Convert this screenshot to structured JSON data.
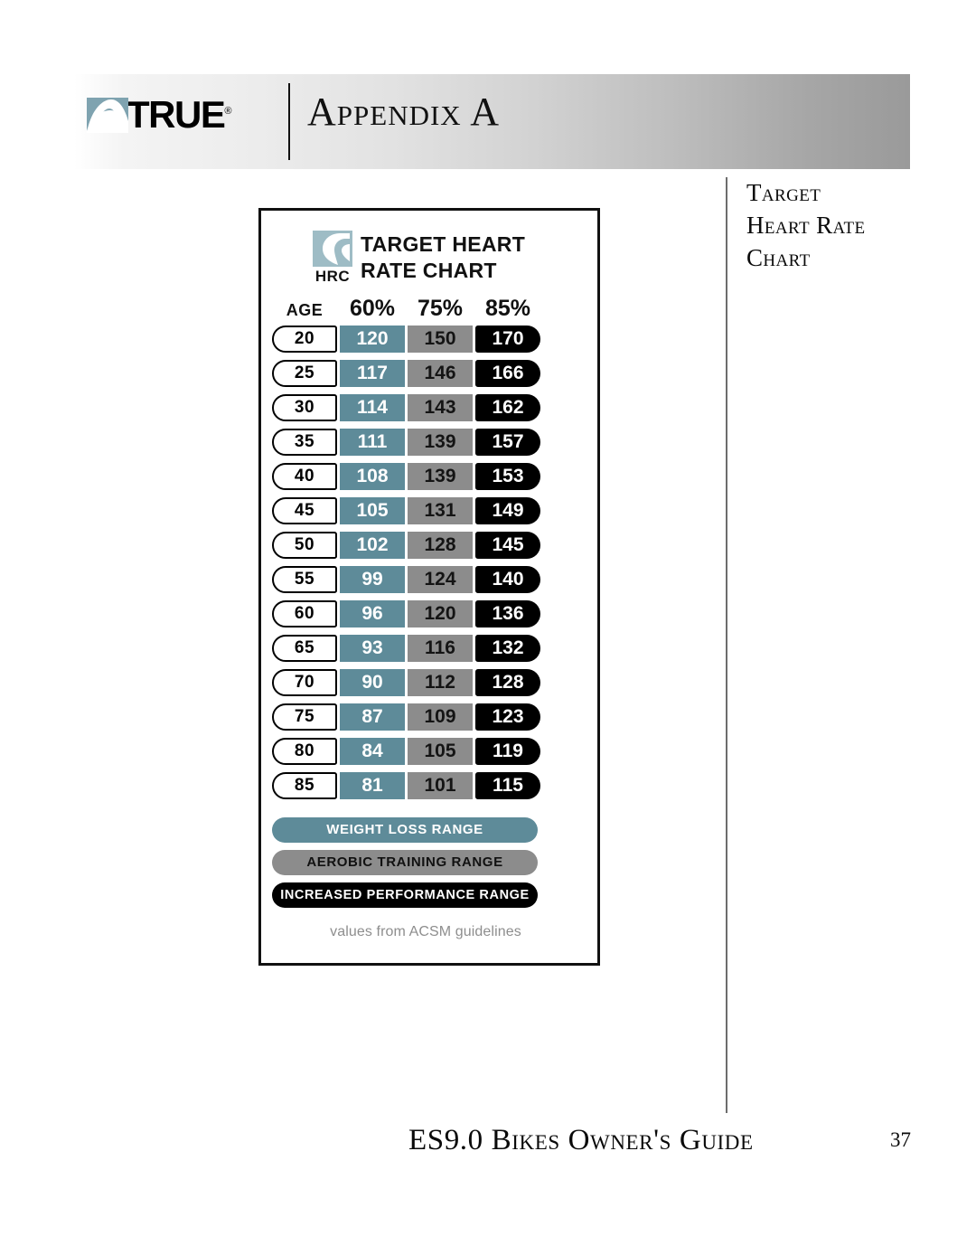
{
  "header": {
    "brand_word": "TRUE",
    "brand_tm": "®",
    "title": "Appendix A",
    "logo_icon": "true-arch-logo-icon",
    "divider_icon": "vertical-divider-icon"
  },
  "side_title": {
    "line1": "Target",
    "line2": "Heart Rate",
    "line3": "Chart"
  },
  "card": {
    "badge_label": "HRC",
    "badge_icon": "hrc-heart-mark-icon",
    "title_line1": "TARGET HEART",
    "title_line2": "RATE CHART",
    "source_note": "values from ACSM guidelines",
    "legend": [
      {
        "label": "WEIGHT LOSS RANGE",
        "color": "#5e8b99",
        "text_color": "#ffffff"
      },
      {
        "label": "AEROBIC TRAINING RANGE",
        "color": "#8c8c8c",
        "text_color": "#111111"
      },
      {
        "label": "INCREASED PERFORMANCE RANGE",
        "color": "#000000",
        "text_color": "#ffffff"
      }
    ]
  },
  "footer": {
    "title": "ES9.0 Bikes Owner's Guide",
    "page_number": "37"
  },
  "chart_data": {
    "type": "table",
    "title": "TARGET HEART RATE CHART",
    "subtitle": "values from ACSM guidelines",
    "columns": [
      "AGE",
      "60%",
      "75%",
      "85%"
    ],
    "column_colors": [
      "#ffffff",
      "#5e8b99",
      "#8c8c8c",
      "#000000"
    ],
    "column_meaning": [
      "Age (years)",
      "Weight Loss Range",
      "Aerobic Training Range",
      "Increased Performance Range"
    ],
    "rows": [
      {
        "age": "20",
        "p60": "120",
        "p75": "150",
        "p85": "170"
      },
      {
        "age": "25",
        "p60": "117",
        "p75": "146",
        "p85": "166"
      },
      {
        "age": "30",
        "p60": "114",
        "p75": "143",
        "p85": "162"
      },
      {
        "age": "35",
        "p60": "111",
        "p75": "139",
        "p85": "157"
      },
      {
        "age": "40",
        "p60": "108",
        "p75": "139",
        "p85": "153"
      },
      {
        "age": "45",
        "p60": "105",
        "p75": "131",
        "p85": "149"
      },
      {
        "age": "50",
        "p60": "102",
        "p75": "128",
        "p85": "145"
      },
      {
        "age": "55",
        "p60": "99",
        "p75": "124",
        "p85": "140"
      },
      {
        "age": "60",
        "p60": "96",
        "p75": "120",
        "p85": "136"
      },
      {
        "age": "65",
        "p60": "93",
        "p75": "116",
        "p85": "132"
      },
      {
        "age": "70",
        "p60": "90",
        "p75": "112",
        "p85": "128"
      },
      {
        "age": "75",
        "p60": "87",
        "p75": "109",
        "p85": "123"
      },
      {
        "age": "80",
        "p60": "84",
        "p75": "105",
        "p85": "119"
      },
      {
        "age": "85",
        "p60": "81",
        "p75": "101",
        "p85": "115"
      }
    ],
    "categories": [
      20,
      25,
      30,
      35,
      40,
      45,
      50,
      55,
      60,
      65,
      70,
      75,
      80,
      85
    ],
    "series": [
      {
        "name": "60%",
        "values": [
          120,
          117,
          114,
          111,
          108,
          105,
          102,
          99,
          96,
          93,
          90,
          87,
          84,
          81
        ]
      },
      {
        "name": "75%",
        "values": [
          150,
          146,
          143,
          139,
          139,
          131,
          128,
          124,
          120,
          116,
          112,
          109,
          105,
          101
        ]
      },
      {
        "name": "85%",
        "values": [
          170,
          166,
          162,
          157,
          153,
          149,
          145,
          140,
          136,
          132,
          128,
          123,
          119,
          115
        ]
      }
    ],
    "xlabel": "AGE",
    "ylabel": "Target Heart Rate (bpm)"
  }
}
